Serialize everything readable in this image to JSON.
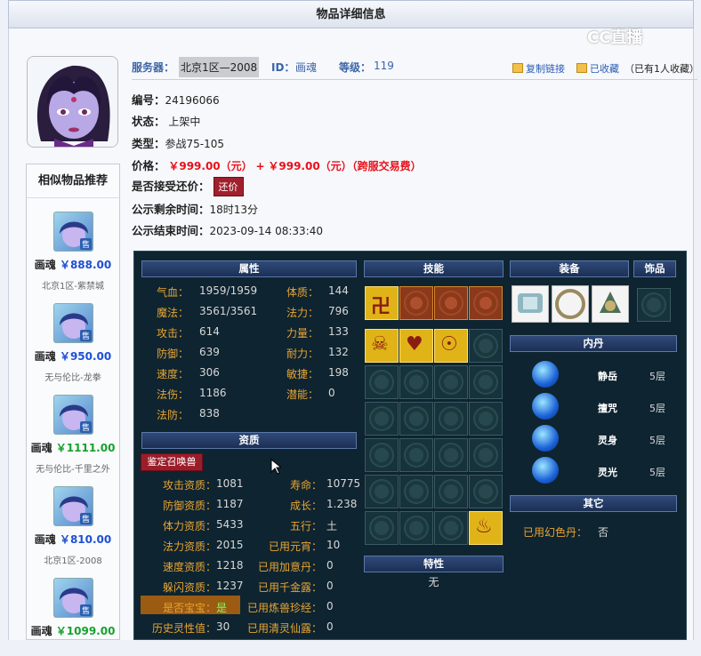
{
  "header": {
    "title": "物品详细信息"
  },
  "watermark": "CC直播",
  "sidebar": {
    "title": "相似物品推荐",
    "items": [
      {
        "name": "画魂",
        "price": "￥888.00",
        "price_color": "#1f4fd4",
        "server": "北京1区-紫禁城",
        "tag": "售"
      },
      {
        "name": "画魂",
        "price": "￥950.00",
        "price_color": "#1f4fd4",
        "server": "无与伦比-龙拳",
        "tag": "售"
      },
      {
        "name": "画魂",
        "price": "￥1111.00",
        "price_color": "#17a12d",
        "server": "无与伦比-千里之外",
        "tag": "售"
      },
      {
        "name": "画魂",
        "price": "￥810.00",
        "price_color": "#1f4fd4",
        "server": "北京1区-2008",
        "tag": "售"
      },
      {
        "name": "画魂",
        "price": "￥1099.00",
        "price_color": "#17a12d",
        "server": "",
        "tag": "售"
      }
    ]
  },
  "info": {
    "server_label": "服务器：",
    "server": "北京1区—2008",
    "id_label": "ID：",
    "id": "画魂",
    "level_label": "等级：",
    "level": "119",
    "copy_link": "复制链接",
    "favorited": "已收藏",
    "fav_count": "（已有1人收藏）",
    "number_label": "编号：",
    "number": "24196066",
    "status_label": "状态：",
    "status": "上架中",
    "type_label": "类型：",
    "type": "参战75-105",
    "price_label": "价格：",
    "price": "￥999.00（元）",
    "plus": "+",
    "cross_price": "￥999.00（元）（跨服交易费）",
    "counter_label": "是否接受还价：",
    "counter_btn": "还价",
    "remain_label": "公示剩余时间：",
    "remain": "18时13分",
    "end_label": "公示结束时间：",
    "end": "2023-09-14 08:33:40"
  },
  "attr": {
    "title": "属性",
    "rows": [
      {
        "l1": "气血：",
        "v1": "1959/1959",
        "l2": "体质：",
        "v2": "144"
      },
      {
        "l1": "魔法：",
        "v1": "3561/3561",
        "l2": "法力：",
        "v2": "796"
      },
      {
        "l1": "攻击：",
        "v1": "614",
        "l2": "力量：",
        "v2": "133"
      },
      {
        "l1": "防御：",
        "v1": "639",
        "l2": "耐力：",
        "v2": "132"
      },
      {
        "l1": "速度：",
        "v1": "306",
        "l2": "敏捷：",
        "v2": "198"
      },
      {
        "l1": "法伤：",
        "v1": "1186",
        "l2": "潜能：",
        "v2": "0"
      },
      {
        "l1": "法防：",
        "v1": "838",
        "l2": "",
        "v2": ""
      }
    ]
  },
  "zizhi": {
    "title": "资质",
    "appraise": "鉴定召唤兽",
    "rows": [
      {
        "l1": "攻击资质：",
        "v1": "1081",
        "l2": "寿命：",
        "v2": "10775"
      },
      {
        "l1": "防御资质：",
        "v1": "1187",
        "l2": "成长：",
        "v2": "1.238"
      },
      {
        "l1": "体力资质：",
        "v1": "5433",
        "l2": "五行：",
        "v2": "土"
      },
      {
        "l1": "法力资质：",
        "v1": "2015",
        "l2": "已用元宵：",
        "v2": "10"
      },
      {
        "l1": "速度资质：",
        "v1": "1218",
        "l2": "已用加意丹：",
        "v2": "0"
      },
      {
        "l1": "躲闪资质：",
        "v1": "1237",
        "l2": "已用千金露：",
        "v2": "0"
      },
      {
        "l1": "是否宝宝：",
        "v1": "是",
        "l2": "已用炼兽珍经：",
        "v2": "0"
      },
      {
        "l1": "历史灵性值：",
        "v1": "30",
        "l2": "已用清灵仙露：",
        "v2": "0"
      }
    ]
  },
  "skills": {
    "title": "技能"
  },
  "trait": {
    "title": "特性",
    "value": "无"
  },
  "equip": {
    "title": "装备",
    "jewel": "饰品"
  },
  "neidan": {
    "title": "内丹",
    "items": [
      {
        "name": "静岳",
        "level": "5层"
      },
      {
        "name": "擅咒",
        "level": "5层"
      },
      {
        "name": "灵身",
        "level": "5层"
      },
      {
        "name": "灵光",
        "level": "5层"
      }
    ]
  },
  "other": {
    "title": "其它",
    "label": "已用幻色丹：",
    "value": "否"
  }
}
